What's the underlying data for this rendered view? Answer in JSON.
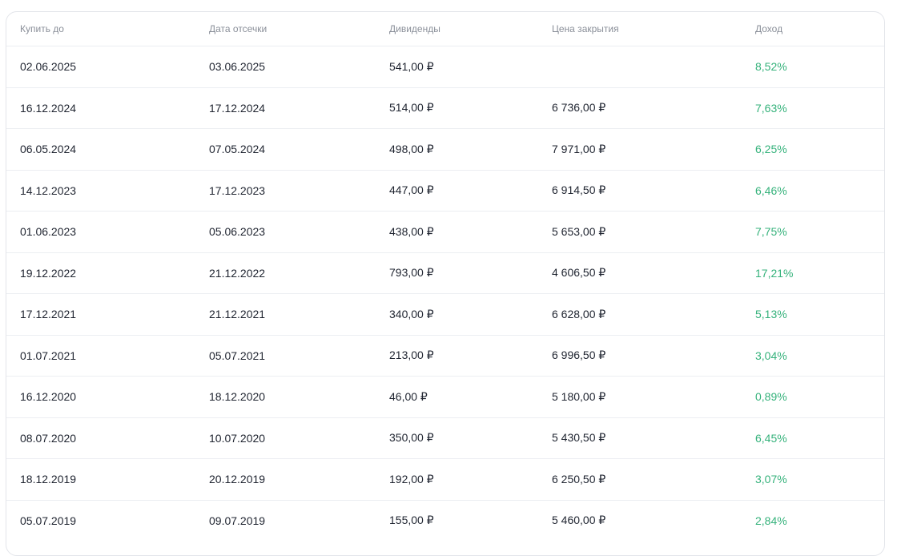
{
  "table": {
    "headers": [
      "Купить до",
      "Дата отсечки",
      "Дивиденды",
      "Цена закрытия",
      "Доход"
    ],
    "rows": [
      {
        "buy_before": "02.06.2025",
        "record_date": "03.06.2025",
        "dividend": "541,00 ₽",
        "close_price": "",
        "yield": "8,52%"
      },
      {
        "buy_before": "16.12.2024",
        "record_date": "17.12.2024",
        "dividend": "514,00 ₽",
        "close_price": "6 736,00 ₽",
        "yield": "7,63%"
      },
      {
        "buy_before": "06.05.2024",
        "record_date": "07.05.2024",
        "dividend": "498,00 ₽",
        "close_price": "7 971,00 ₽",
        "yield": "6,25%"
      },
      {
        "buy_before": "14.12.2023",
        "record_date": "17.12.2023",
        "dividend": "447,00 ₽",
        "close_price": "6 914,50 ₽",
        "yield": "6,46%"
      },
      {
        "buy_before": "01.06.2023",
        "record_date": "05.06.2023",
        "dividend": "438,00 ₽",
        "close_price": "5 653,00 ₽",
        "yield": "7,75%"
      },
      {
        "buy_before": "19.12.2022",
        "record_date": "21.12.2022",
        "dividend": "793,00 ₽",
        "close_price": "4 606,50 ₽",
        "yield": "17,21%"
      },
      {
        "buy_before": "17.12.2021",
        "record_date": "21.12.2021",
        "dividend": "340,00 ₽",
        "close_price": "6 628,00 ₽",
        "yield": "5,13%"
      },
      {
        "buy_before": "01.07.2021",
        "record_date": "05.07.2021",
        "dividend": "213,00 ₽",
        "close_price": "6 996,50 ₽",
        "yield": "3,04%"
      },
      {
        "buy_before": "16.12.2020",
        "record_date": "18.12.2020",
        "dividend": "46,00 ₽",
        "close_price": "5 180,00 ₽",
        "yield": "0,89%"
      },
      {
        "buy_before": "08.07.2020",
        "record_date": "10.07.2020",
        "dividend": "350,00 ₽",
        "close_price": "5 430,50 ₽",
        "yield": "6,45%"
      },
      {
        "buy_before": "18.12.2019",
        "record_date": "20.12.2019",
        "dividend": "192,00 ₽",
        "close_price": "6 250,50 ₽",
        "yield": "3,07%"
      },
      {
        "buy_before": "05.07.2019",
        "record_date": "09.07.2019",
        "dividend": "155,00 ₽",
        "close_price": "5 460,00 ₽",
        "yield": "2,84%"
      }
    ]
  },
  "colors": {
    "yield": "#35b27b",
    "text": "#1f2430",
    "header_text": "#8a8f99",
    "border": "#e3e5ea"
  }
}
